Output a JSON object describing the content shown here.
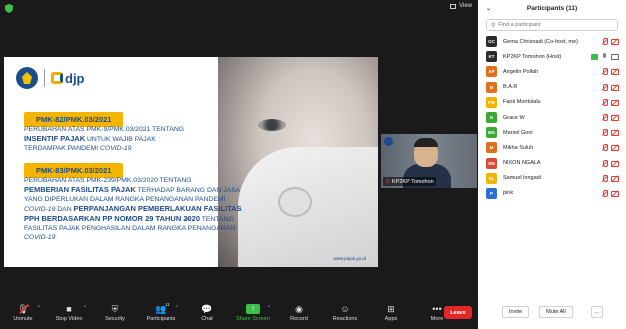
{
  "window": {
    "view_label": "View"
  },
  "slide": {
    "logo_text": "djp",
    "badge1": "PMK-82/PMK.03/2021",
    "text1_line1": "PERUBAHAN ATAS PMK-9/PMK.03/2021 TENTANG",
    "text1_bold": "INSENTIF PAJAK",
    "text1_line2": "UNTUK WAJIB PAJAK",
    "text1_line3": "TERDAMPAK PANDEMI",
    "text1_italic": "COVID-19",
    "badge2": "PMK-83/PMK.03/2021",
    "text2_line1": "PERUBAHAN ATAS PMK-239/PMK.03/2020 TENTANG",
    "text2_bold1": "PEMBERIAN FASILITAS PAJAK",
    "text2_line2": "TERHADAP BARANG DAN JASA YANG DIPERLUKAN DALAM RANGKA PENANGANAN PANDEMI",
    "text2_italic1": "COVID-19",
    "text2_and": "DAN",
    "text2_bold2": "PERPANJANGAN PEMBERLAKUAN FASILITAS PPH BERDASARKAN PP NOMOR 29 TAHUN 2020",
    "text2_line3": "TENTANG FASILITAS PAJAK PENGHASILAN DALAM RANGKA PENANGANAN",
    "text2_italic2": "COVID-19",
    "url": "www.pajak.go.id"
  },
  "video_tile": {
    "name": "KP2KP Tomohon"
  },
  "toolbar": {
    "unmute": "Unmute",
    "stop_video": "Stop Video",
    "security": "Security",
    "participants": "Participants",
    "participants_count": "11",
    "chat": "Chat",
    "share_screen": "Share Screen",
    "record": "Record",
    "reactions": "Reactions",
    "apps": "Apps",
    "more": "More",
    "leave": "Leave"
  },
  "panel": {
    "title": "Participants (11)",
    "search_placeholder": "Find a participant",
    "participants": [
      {
        "initials": "GC",
        "name": "Gema Chrisnadi (Co-host, me)",
        "color": "#2b2b2b",
        "mic": "off",
        "cam": "off"
      },
      {
        "initials": "KT",
        "name": "KP2KP Tomohon (Host)",
        "color": "#2b2b2b",
        "mic": "on",
        "cam": "on",
        "sharing": true
      },
      {
        "initials": "AP",
        "name": "Angelin Pollah",
        "color": "#e06f1f",
        "mic": "off",
        "cam": "off"
      },
      {
        "initials": "B",
        "name": "B.A.R",
        "color": "#e06f1f",
        "mic": "off",
        "cam": "off"
      },
      {
        "initials": "FM",
        "name": "Fanti Montolalu",
        "color": "#f0b400",
        "mic": "off",
        "cam": "off"
      },
      {
        "initials": "G",
        "name": "Grace W",
        "color": "#3aaa35",
        "mic": "off",
        "cam": "off"
      },
      {
        "initials": "MG",
        "name": "Marsel Goni",
        "color": "#3aaa35",
        "mic": "off",
        "cam": "off"
      },
      {
        "initials": "M",
        "name": "Mikha Suluh",
        "color": "#e06f1f",
        "mic": "off",
        "cam": "off"
      },
      {
        "initials": "NN",
        "name": "NIXON NGALA",
        "color": "#d84a3a",
        "mic": "off",
        "cam": "off"
      },
      {
        "initials": "SL",
        "name": "Samuel longadi",
        "color": "#f0b400",
        "mic": "off",
        "cam": "off"
      },
      {
        "initials": "P",
        "name": "pink",
        "color": "#2d6fd6",
        "mic": "off",
        "cam": "off"
      }
    ],
    "invite": "Invite",
    "mute_all": "Mute All",
    "more": "..."
  }
}
